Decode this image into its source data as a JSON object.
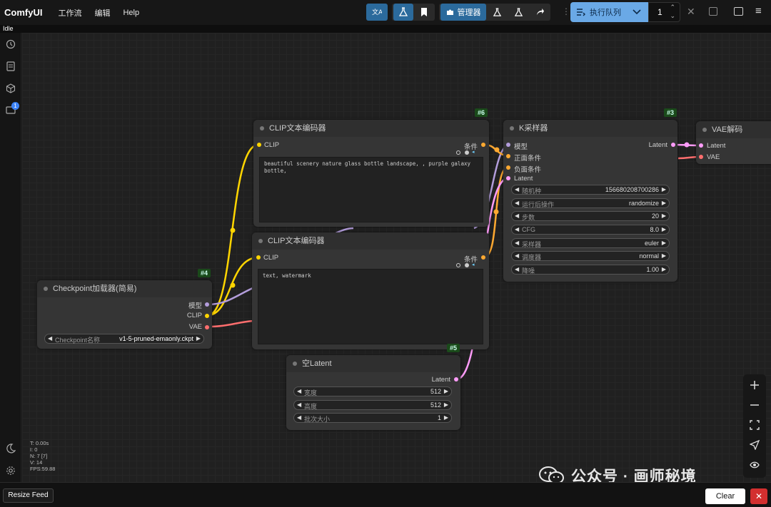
{
  "app": {
    "title": "ComfyUI",
    "status": "Idle"
  },
  "menu": [
    "工作流",
    "编辑",
    "Help"
  ],
  "toolbar": {
    "manager_label": "管理器",
    "queue_label": "执行队列",
    "queue_count": "1"
  },
  "sidebar": {
    "badge": "1"
  },
  "stats": {
    "t": "T: 0.00s",
    "i": "I: 0",
    "n": "N: 7 [7]",
    "v": "V: 14",
    "fps": "FPS:59.88"
  },
  "nodes": {
    "clip_pos": {
      "id": "#6",
      "title": "CLIP文本编码器",
      "input": "CLIP",
      "output": "条件",
      "text": "beautiful scenery nature glass bottle landscape, , purple galaxy bottle,"
    },
    "clip_neg": {
      "id": "#7",
      "title": "CLIP文本编码器",
      "input": "CLIP",
      "output": "条件",
      "text": "text, watermark"
    },
    "ksampler": {
      "id": "#3",
      "title": "K采样器",
      "inputs": [
        "模型",
        "正面条件",
        "负面条件",
        "Latent"
      ],
      "output": "Latent",
      "widgets": [
        {
          "label": "随机种",
          "value": "156680208700286"
        },
        {
          "label": "运行后操作",
          "value": "randomize"
        },
        {
          "label": "步数",
          "value": "20"
        },
        {
          "label": "CFG",
          "value": "8.0"
        },
        {
          "label": "采样器",
          "value": "euler"
        },
        {
          "label": "调度器",
          "value": "normal"
        },
        {
          "label": "降噪",
          "value": "1.00"
        }
      ]
    },
    "vae_decode": {
      "title": "VAE解码",
      "inputs": [
        "Latent",
        "VAE"
      ]
    },
    "checkpoint": {
      "id": "#4",
      "title": "Checkpoint加载器(简易)",
      "outputs": [
        "模型",
        "CLIP",
        "VAE"
      ],
      "widget": {
        "label": "Checkpoint名称",
        "value": "v1-5-pruned-emaonly.ckpt"
      }
    },
    "empty_latent": {
      "id": "#5",
      "title": "空Latent",
      "output": "Latent",
      "widgets": [
        {
          "label": "宽度",
          "value": "512"
        },
        {
          "label": "高度",
          "value": "512"
        },
        {
          "label": "批次大小",
          "value": "1"
        }
      ]
    }
  },
  "colors": {
    "clip": "#ffd500",
    "model": "#b39ddb",
    "vae": "#ff6e6e",
    "conditioning": "#ffa931",
    "latent": "#ff9cf9",
    "accent": "#6aa9e6"
  },
  "bottom": {
    "resize_label": "Resize Feed",
    "clear_label": "Clear"
  },
  "watermark": "公众号 · 画师秘境"
}
